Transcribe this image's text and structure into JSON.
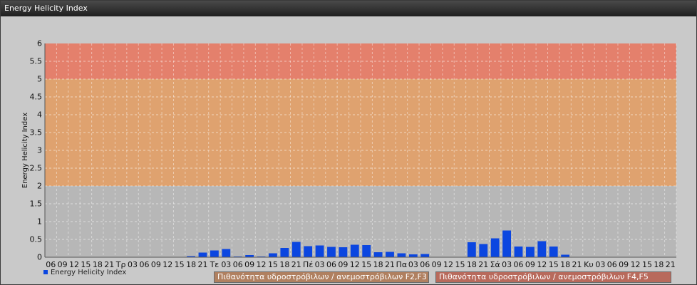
{
  "window": {
    "title": "Energy Helicity Index"
  },
  "legend": {
    "series_label": "Energy Helicity Index",
    "band_f2f3": "Πιθανότητα υδροστρόβιλων / ανεμοστρόβιλων F2,F3",
    "band_f4f5": "Πιθανότητα υδροστρόβιλων / ανεμοστρόβιλων F4,F5"
  },
  "colors": {
    "bar": "#0b46e0",
    "band_low": "#b7b7b7",
    "band_mid": "#dfa26f",
    "band_high": "#e4806c",
    "legend_f2f3": "#b08060",
    "legend_f4f5": "#b86a5c"
  },
  "chart_data": {
    "type": "bar",
    "ylabel": "Energy Helicity Index",
    "ylim": [
      0,
      6
    ],
    "yticks": [
      "0",
      "0.5",
      "1",
      "1.5",
      "2",
      "2.5",
      "3",
      "3.5",
      "4",
      "4.5",
      "5",
      "5.5",
      "6"
    ],
    "grid": true,
    "bands": [
      {
        "from": 0,
        "to": 2,
        "color": "#b7b7b7"
      },
      {
        "from": 2,
        "to": 5,
        "color": "#dfa26f"
      },
      {
        "from": 5,
        "to": 6,
        "color": "#e4806c"
      }
    ],
    "categories": [
      "06",
      "09",
      "12",
      "15",
      "18",
      "21",
      "Τρ",
      "03",
      "06",
      "09",
      "12",
      "15",
      "18",
      "21",
      "Τε",
      "03",
      "06",
      "09",
      "12",
      "15",
      "18",
      "21",
      "Πέ",
      "03",
      "06",
      "09",
      "12",
      "15",
      "18",
      "21",
      "Πα",
      "03",
      "06",
      "09",
      "12",
      "15",
      "18",
      "21",
      "Σά",
      "03",
      "06",
      "09",
      "12",
      "15",
      "18",
      "21",
      "Κυ",
      "03",
      "06",
      "09",
      "12",
      "15",
      "18",
      "21"
    ],
    "series": [
      {
        "name": "Energy Helicity Index",
        "values": [
          0.01,
          0.01,
          0.01,
          0.01,
          0.01,
          0.01,
          0.01,
          0.01,
          0.01,
          0.01,
          0.01,
          0.01,
          0.03,
          0.13,
          0.19,
          0.23,
          0.02,
          0.06,
          0.02,
          0.11,
          0.26,
          0.43,
          0.31,
          0.33,
          0.29,
          0.28,
          0.35,
          0.34,
          0.14,
          0.15,
          0.11,
          0.08,
          0.09,
          0.01,
          0.01,
          0.01,
          0.42,
          0.37,
          0.53,
          0.75,
          0.3,
          0.29,
          0.45,
          0.3,
          0.07,
          0.01,
          0.01,
          0.01,
          0.01,
          0.01,
          0.01,
          0.01,
          0.01,
          0.01
        ]
      }
    ]
  }
}
